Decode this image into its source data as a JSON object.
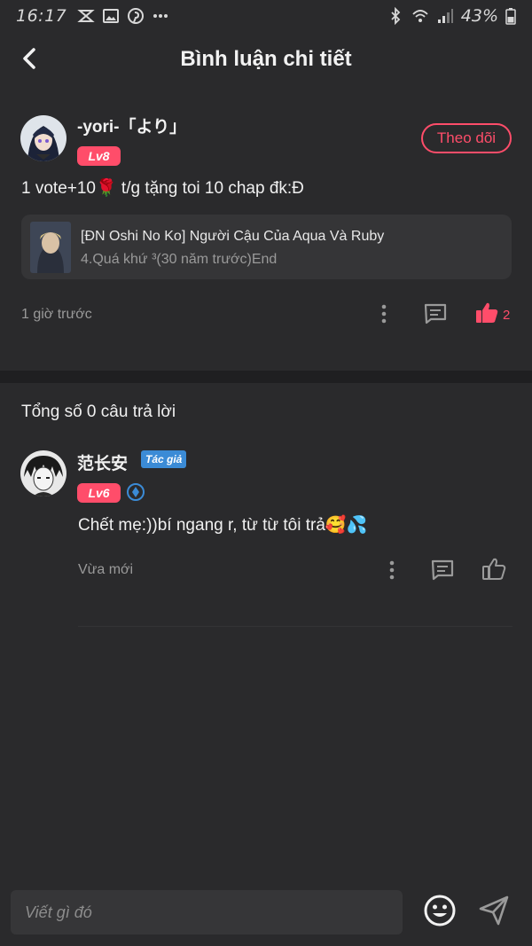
{
  "status_bar": {
    "time": "16:17",
    "battery": "43%"
  },
  "header": {
    "title": "Bình luận chi tiết"
  },
  "comment": {
    "username": "-yori-「より」",
    "level": "Lv8",
    "follow_label": "Theo dõi",
    "text": "1 vote+10🌹 t/g tặng toi 10 chap đk:Đ",
    "story": {
      "title": "[ĐN Oshi No Ko] Người Cậu Của Aqua Và Ruby",
      "chapter": "4.Quá khứ ³(30 năm trước)End"
    },
    "time": "1 giờ trước",
    "like_count": "2"
  },
  "replies": {
    "heading": "Tổng số 0 câu trả lời",
    "items": [
      {
        "username": "范长安",
        "tag": "Tác giả",
        "level": "Lv6",
        "text": "Chết mẹ:))bí ngang r, từ từ tôi trả🥰💦",
        "time": "Vừa mới"
      }
    ]
  },
  "composer": {
    "placeholder": "Viết gì đó"
  },
  "colors": {
    "background": "#2a2a2c",
    "accent": "#ff4d6a",
    "author_tag": "#3b8bd6",
    "divider": "#1f1f21"
  },
  "icons": [
    "back-arrow-icon",
    "more-vertical-icon",
    "comment-icon",
    "thumbs-up-icon",
    "emoji-icon",
    "send-icon",
    "verified-icon"
  ]
}
